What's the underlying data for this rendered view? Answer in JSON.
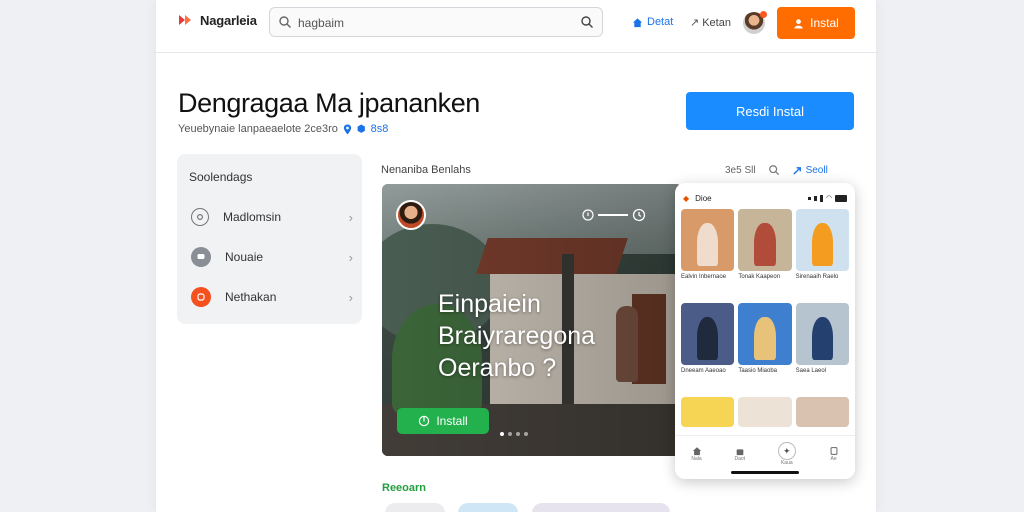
{
  "header": {
    "brand": "Nagarleia",
    "search_value": "hagbaim",
    "nav_a": "Detat",
    "nav_b": "Ketan",
    "install_label": "Instal"
  },
  "page": {
    "title": "Dengragaa Ma jpananken",
    "subtitle": "Yeuebynaie lanpaeaelote 2ce3ro",
    "meta_count": "8s8",
    "cta_label": "Resdi Instal"
  },
  "sidebar": {
    "heading": "Soolendags",
    "items": [
      {
        "label": "Madlomsin",
        "icon": "circle-icon",
        "color": "#5f6368"
      },
      {
        "label": "Nouaie",
        "icon": "chat-icon",
        "color": "#5f6368"
      },
      {
        "label": "Nethakan",
        "icon": "record-icon",
        "color": "#f4511e"
      }
    ]
  },
  "feature": {
    "section_label": "Nenaniba Benlahs",
    "tool_count": "3e5 Sll",
    "share_label": "Seoll",
    "headline_lines": [
      "Einpaiein",
      "Braiyraregona",
      "Oeranbo ?"
    ],
    "install_label": "Install"
  },
  "phone": {
    "app_label": "Dioe",
    "captions": [
      "Ealvin Inbernaoe",
      "Tonak Kaapeon",
      "Sirenaaih Raelo",
      "Dneeam Aaeoao",
      "Taasio Miaoba",
      "Saea Laeol"
    ],
    "tabs": [
      "Nala",
      "Daot",
      "Kaua",
      "Ae"
    ]
  },
  "footer": {
    "section_label": "Reeoarn"
  },
  "colors": {
    "accent_orange": "#ff6d00",
    "accent_blue": "#1a8cff",
    "accent_green": "#22b14c"
  }
}
